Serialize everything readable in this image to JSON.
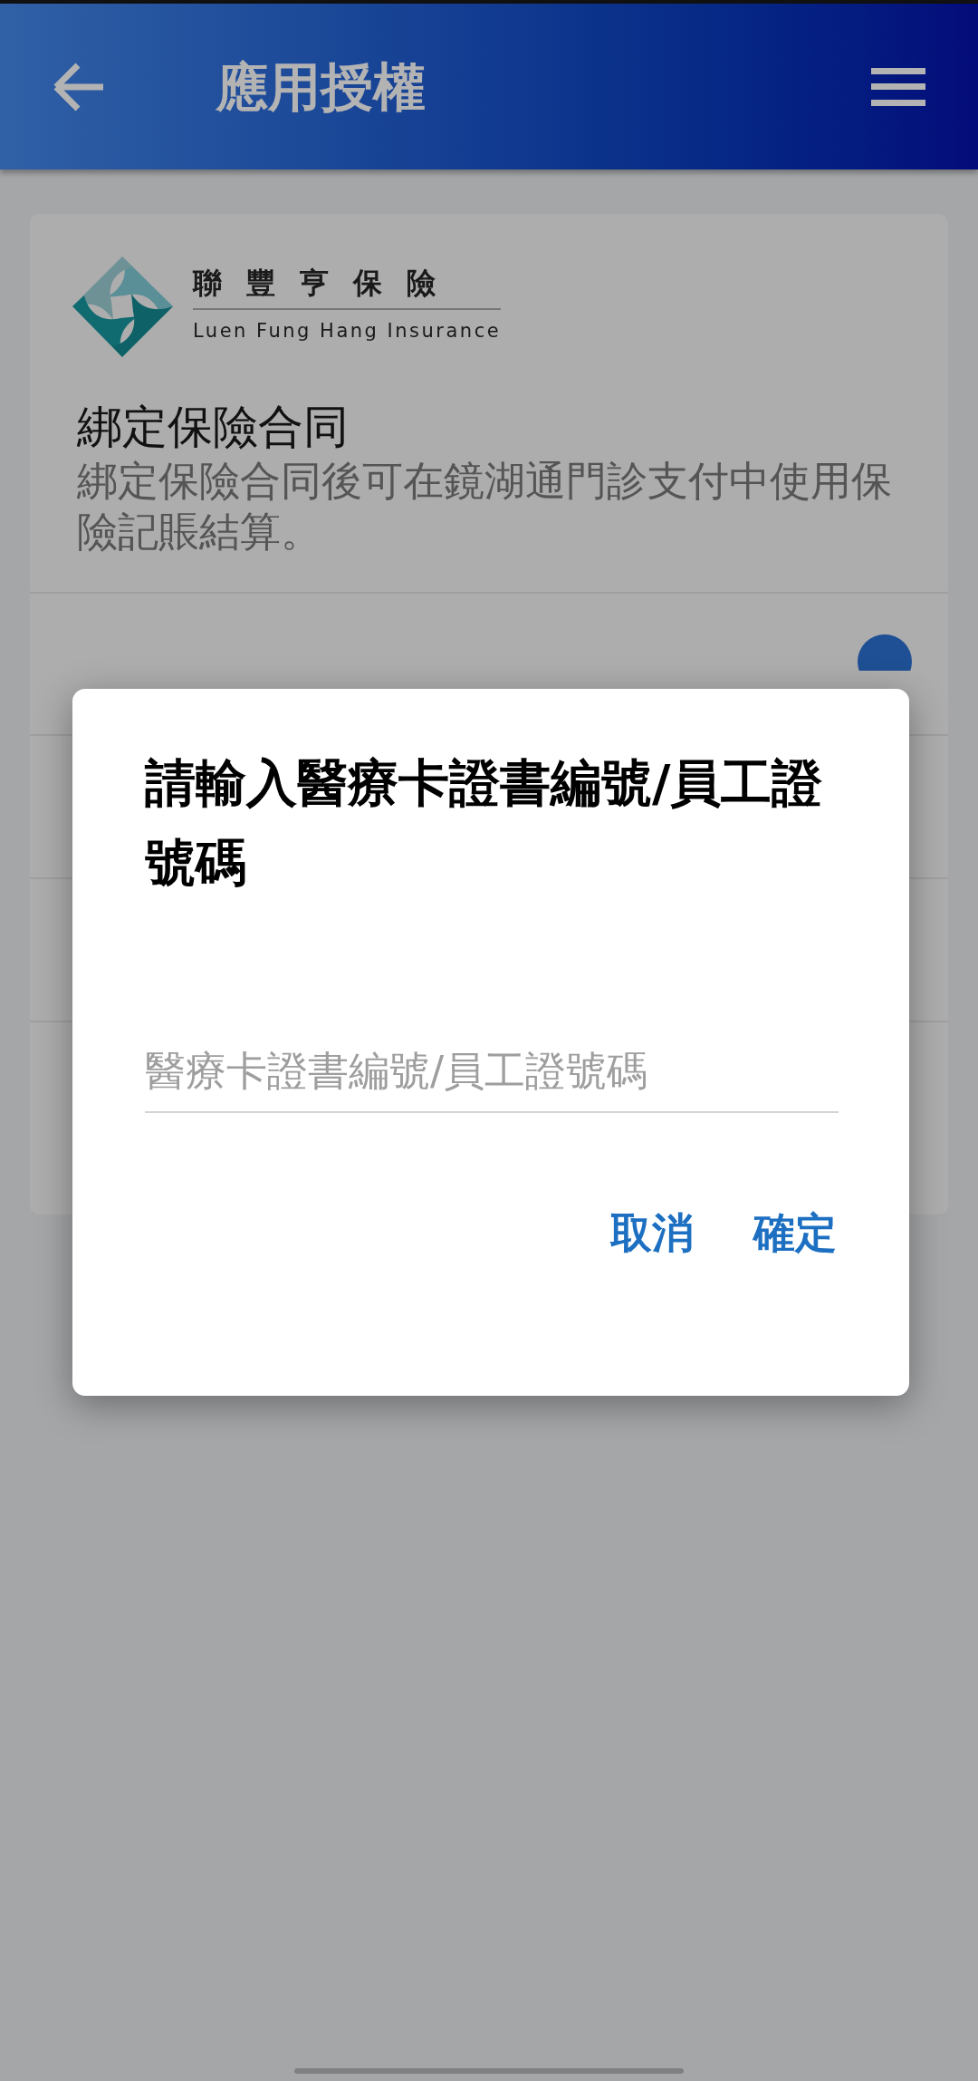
{
  "header": {
    "title": "應用授權"
  },
  "card": {
    "logo_chinese": "聯豐亨保險",
    "logo_english": "Luen Fung Hang Insurance",
    "title": "綁定保險合同",
    "description": "綁定保險合同後可在鏡湖通門診支付中使用保險記賬結算。"
  },
  "dialog": {
    "title": "請輸入醫療卡證書編號/員工證號碼",
    "input": {
      "placeholder": "醫療卡證書編號/員工證號碼"
    },
    "buttons": [
      {
        "label": "取消"
      },
      {
        "label": "確定"
      }
    ]
  }
}
